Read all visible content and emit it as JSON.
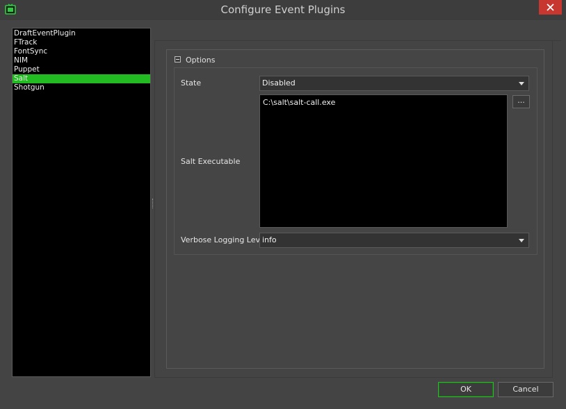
{
  "window": {
    "title": "Configure Event Plugins",
    "close_icon": "close-icon",
    "app_icon": "tv-app-icon",
    "accent": "#22bb22"
  },
  "plugins": [
    {
      "label": "DraftEventPlugin",
      "selected": false
    },
    {
      "label": "FTrack",
      "selected": false
    },
    {
      "label": "FontSync",
      "selected": false
    },
    {
      "label": "NIM",
      "selected": false
    },
    {
      "label": "Puppet",
      "selected": false
    },
    {
      "label": "Salt",
      "selected": true
    },
    {
      "label": "Shotgun",
      "selected": false
    }
  ],
  "options": {
    "group_title": "Options",
    "state": {
      "label": "State",
      "value": "Disabled"
    },
    "salt_executable": {
      "label": "Salt Executable",
      "value": "C:\\salt\\salt-call.exe",
      "browse_label": "..."
    },
    "verbose_logging": {
      "label": "Verbose Logging Level",
      "value": "info"
    }
  },
  "buttons": {
    "ok": "OK",
    "cancel": "Cancel"
  }
}
